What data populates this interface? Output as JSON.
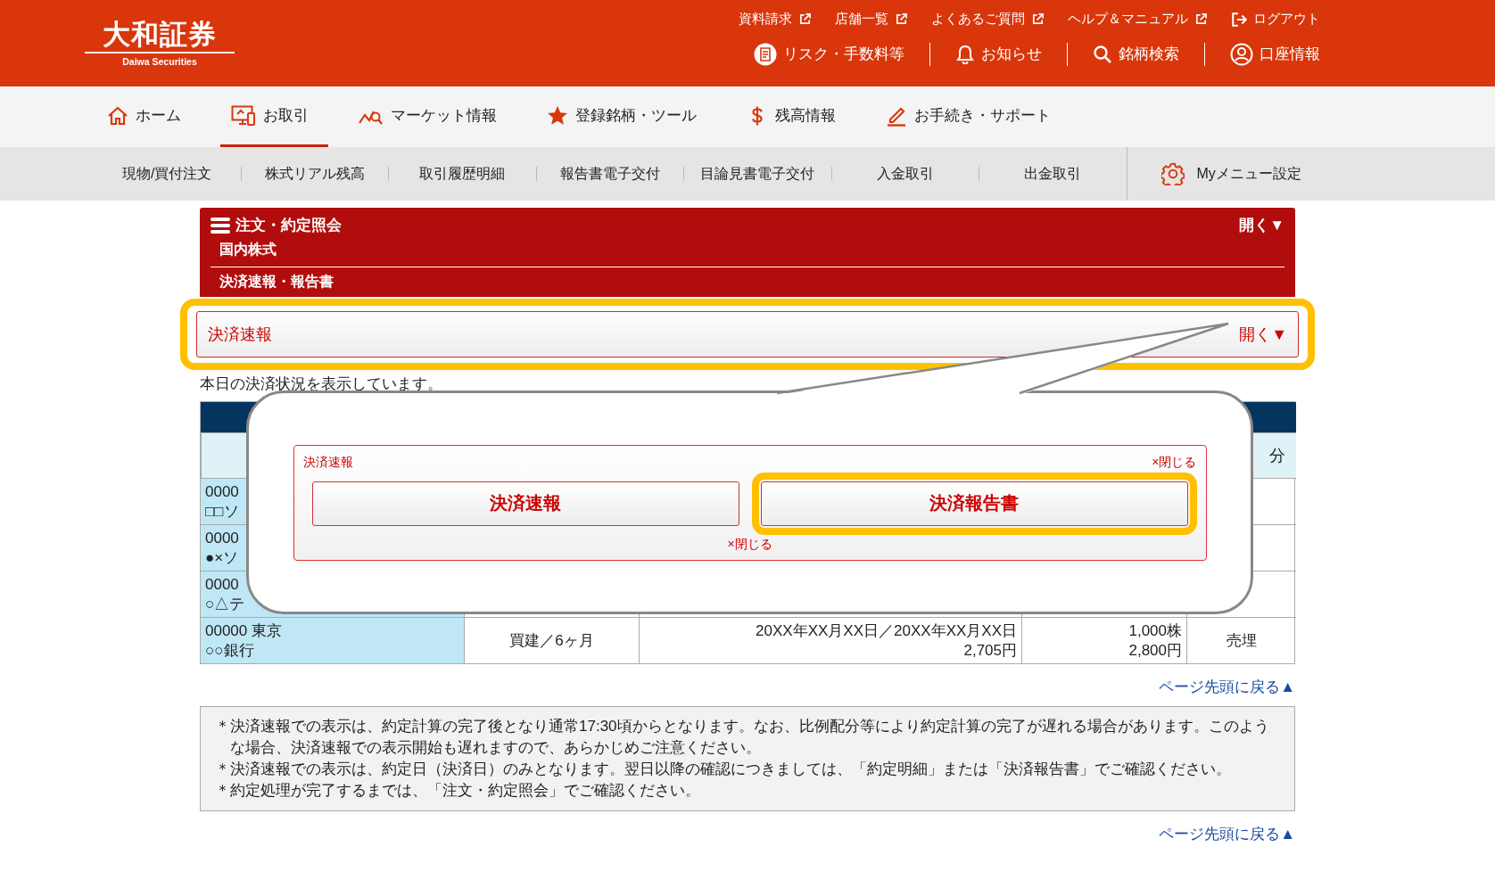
{
  "header": {
    "logo_main": "大和証券",
    "logo_sub": "Daiwa Securities",
    "top_links": [
      {
        "label": "資料請求",
        "kind": "external"
      },
      {
        "label": "店舗一覧",
        "kind": "external"
      },
      {
        "label": "よくあるご質問",
        "kind": "external"
      },
      {
        "label": "ヘルプ＆マニュアル",
        "kind": "external"
      },
      {
        "label": "ログアウト",
        "kind": "logout"
      }
    ],
    "utility_links": [
      {
        "label": "リスク・手数料等",
        "kind": "document"
      },
      {
        "label": "お知らせ",
        "kind": "bell"
      },
      {
        "label": "銘柄検索",
        "kind": "search"
      },
      {
        "label": "口座情報",
        "kind": "account"
      }
    ]
  },
  "nav": [
    {
      "label": "ホーム",
      "kind": "home",
      "selected": false
    },
    {
      "label": "お取引",
      "kind": "trade",
      "selected": true
    },
    {
      "label": "マーケット情報",
      "kind": "market",
      "selected": false
    },
    {
      "label": "登録銘柄・ツール",
      "kind": "star",
      "selected": false
    },
    {
      "label": "残高情報",
      "kind": "dollar",
      "selected": false
    },
    {
      "label": "お手続き・サポート",
      "kind": "pencil",
      "selected": false
    }
  ],
  "subnav": [
    "現物/買付注文",
    "株式リアル残高",
    "取引履歴明細",
    "報告書電子交付",
    "目論見書電子交付",
    "入金取引",
    "出金取引"
  ],
  "my_menu": "Myメニュー設定",
  "panel": {
    "title": "注文・約定照会",
    "toggle": "開く▼",
    "lines": [
      "国内株式",
      "決済速報・報告書"
    ]
  },
  "accordion": {
    "label": "決済速報",
    "toggle": "開く▼",
    "highlighted": true
  },
  "intro": "本日の決済状況を表示しています。",
  "table": {
    "column_5_heading": "分",
    "rows": [
      {
        "code": "0000",
        "name": "□□ソ"
      },
      {
        "code": "0000",
        "name": "●×ソ"
      },
      {
        "code": "0000",
        "name": "○△テ"
      },
      {
        "code": "00000 東京",
        "name": "○○銀行",
        "column_2": "買建／6ヶ月",
        "column_3": [
          "20XX年XX月XX日／20XX年XX月XX日",
          "2,705円"
        ],
        "column_4": [
          "1,000株",
          "2,800円"
        ],
        "column_5": "売埋"
      }
    ]
  },
  "popup": {
    "title": "決済速報",
    "close_top": "×閉じる",
    "buttons": [
      {
        "label": "決済速報",
        "highlighted": false
      },
      {
        "label": "決済報告書",
        "highlighted": true
      }
    ],
    "close_bottom": "×閉じる"
  },
  "back_to_top_upper": "ページ先頭に戻る▲",
  "notes": [
    "＊決済速報での表示は、約定計算の完了後となり通常17:30頃からとなります。なお、比例配分等により約定計算の完了が遅れる場合があります。このような場合、決済速報での表示開始も遅れますので、あらかじめご注意ください。",
    "＊決済速報での表示は、約定日（決済日）のみとなります。翌日以降の確認につきましては、「約定明細」または「決済報告書」でご確認ください。",
    "＊約定処理が完了するまでは、「注文・約定照会」でご確認ください。"
  ],
  "back_to_top_lower": "ページ先頭に戻る▲"
}
